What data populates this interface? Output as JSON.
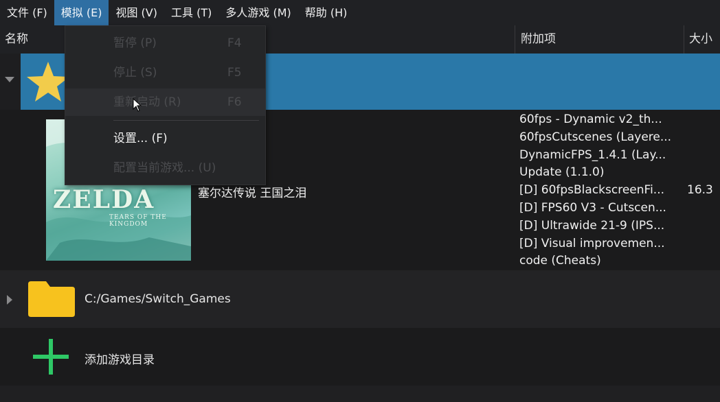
{
  "menubar": [
    {
      "label": "文件 (F)"
    },
    {
      "label": "模拟 (E)"
    },
    {
      "label": "视图 (V)"
    },
    {
      "label": "工具 (T)"
    },
    {
      "label": "多人游戏 (M)"
    },
    {
      "label": "帮助 (H)"
    }
  ],
  "emulation_menu": {
    "items": [
      {
        "label": "暂停 (P)",
        "shortcut": "F4"
      },
      {
        "label": "停止 (S)",
        "shortcut": "F5"
      },
      {
        "label": "重新启动 (R)",
        "shortcut": "F6"
      },
      {
        "label": "设置... (F)",
        "shortcut": ""
      },
      {
        "label": "配置当前游戏... (U)",
        "shortcut": ""
      }
    ]
  },
  "columns": {
    "name": "名称",
    "addons": "附加项",
    "size": "大小"
  },
  "game": {
    "title": "塞尔达传说 王国之泪",
    "cover_logo": "ZELDA",
    "cover_sub": "TEARS OF THE KINGDOM",
    "addons": [
      "60fps - Dynamic v2_th...",
      "60fpsCutscenes (Layere...",
      "DynamicFPS_1.4.1 (Lay...",
      "Update (1.1.0)",
      "[D] 60fpsBlackscreenFi...",
      "[D] FPS60 V3 - Cutscen...",
      "[D] Ultrawide 21-9 (IPS...",
      "[D] Visual improvemen...",
      "code (Cheats)"
    ],
    "size": "16.3"
  },
  "game_dir": {
    "path": "C:/Games/Switch_Games"
  },
  "add_dir": {
    "label": "添加游戏目录"
  },
  "colors": {
    "accent": "#2a78a8",
    "folder": "#f7c21e",
    "plus": "#2ec866",
    "star": "#f2cc4b"
  }
}
